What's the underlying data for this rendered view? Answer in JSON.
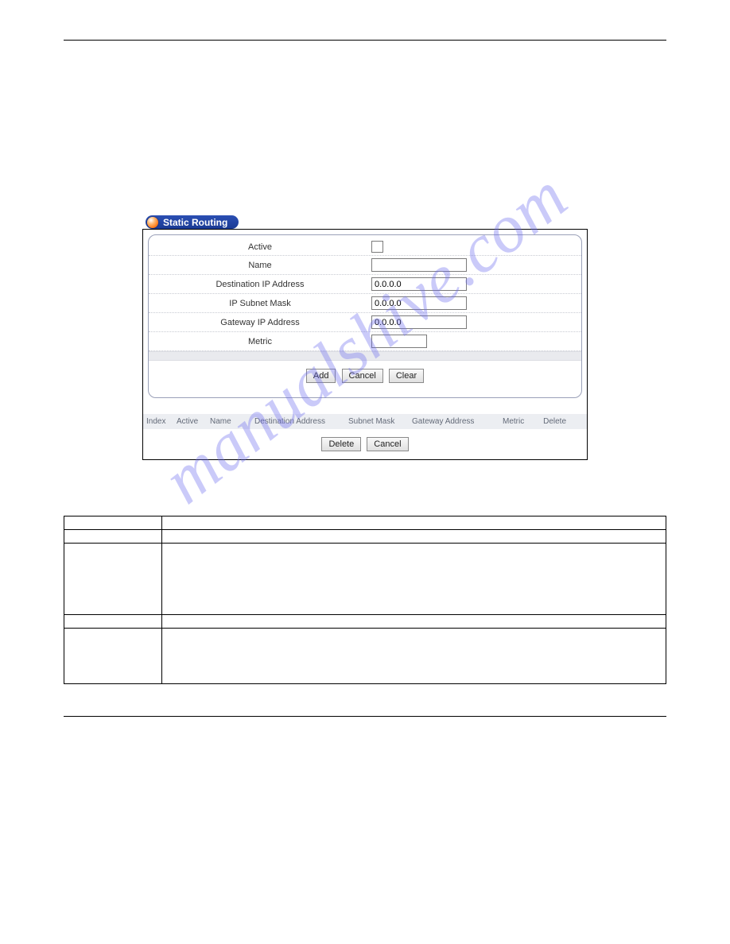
{
  "watermark_text": "manualshive.com",
  "panel": {
    "title": "Static Routing",
    "fields": {
      "active_label": "Active",
      "name_label": "Name",
      "name_value": "",
      "dest_label": "Destination IP Address",
      "dest_value": "0.0.0.0",
      "mask_label": "IP Subnet Mask",
      "mask_value": "0.0.0.0",
      "gw_label": "Gateway IP Address",
      "gw_value": "0.0.0.0",
      "metric_label": "Metric",
      "metric_value": ""
    },
    "buttons": {
      "add": "Add",
      "cancel_top": "Cancel",
      "clear": "Clear",
      "delete": "Delete",
      "cancel_bottom": "Cancel"
    },
    "table_headers": {
      "index": "Index",
      "active": "Active",
      "name": "Name",
      "dest": "Destination Address",
      "mask": "Subnet Mask",
      "gw": "Gateway Address",
      "metric": "Metric",
      "del": "Delete"
    }
  },
  "desc_rows": [
    {
      "label": "",
      "text": ""
    },
    {
      "label": "",
      "text": ""
    },
    {
      "label": "",
      "text": ""
    },
    {
      "label": "",
      "text": ""
    },
    {
      "label": "",
      "text": ""
    }
  ]
}
